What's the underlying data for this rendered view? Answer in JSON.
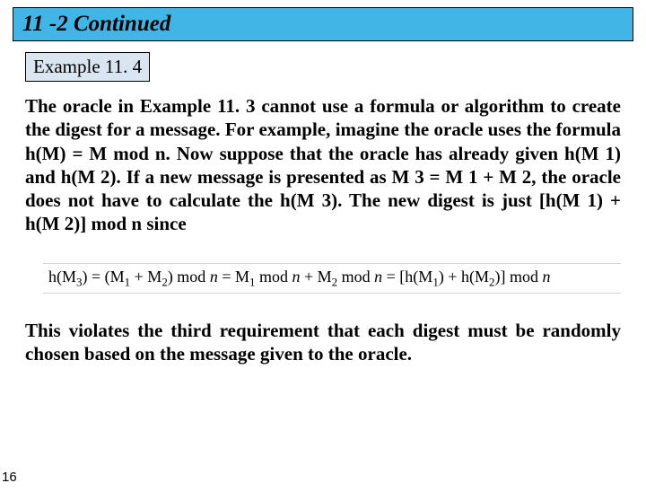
{
  "header": {
    "title": "11 -2   Continued"
  },
  "example_badge": "Example 11. 4",
  "paragraph1": "The oracle in Example 11. 3 cannot use a formula or algorithm to create the digest for a message. For example, imagine the oracle uses the formula h(M) = M mod n. Now suppose that the oracle has already given h(M 1) and h(M 2). If a new message is presented as M 3 = M 1 + M 2, the oracle does not have to calculate the h(M 3). The new digest is just [h(M 1) + h(M 2)] mod n since",
  "formula": {
    "lhs1": "h(M",
    "sub3a": "3",
    "mid1": ") = (M",
    "sub1a": "1",
    "mid2": " + M",
    "sub2a": "2",
    "mid3": ") mod ",
    "nit": "n",
    "mid4": " = M",
    "sub1b": "1",
    "mid5": " mod ",
    "mid6": " + M",
    "sub2b": "2",
    "mid7": " mod ",
    "mid8": " = [h(M",
    "sub1c": "1",
    "mid9": ") + h(M",
    "sub2c": "2",
    "mid10": ")] mod ",
    "tail": "n"
  },
  "paragraph2": "This violates the third requirement that each digest must be randomly chosen based on the message given to the oracle.",
  "page_number": "16"
}
